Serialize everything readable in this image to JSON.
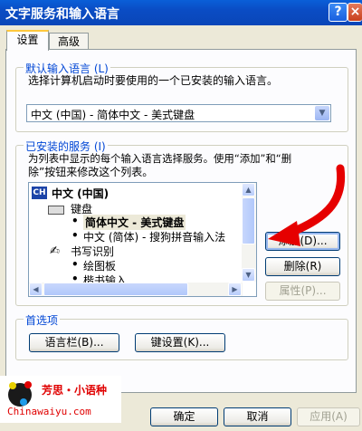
{
  "title": "文字服务和输入语言",
  "title_buttons": {
    "help": "?",
    "close": "×"
  },
  "tabs": [
    {
      "label": "设置"
    },
    {
      "label": "高级"
    }
  ],
  "default_language": {
    "legend": "默认输入语言 (L)",
    "description": "选择计算机启动时要使用的一个已安装的输入语言。",
    "selected": "中文 (中国) - 简体中文 - 美式键盘"
  },
  "installed_services": {
    "legend": "已安装的服务 (I)",
    "description_line1": "为列表中显示的每个输入语言选择服务。使用“添加”和“删",
    "description_line2": "除”按钮来修改这个列表。",
    "tree": {
      "language_icon": "CH",
      "language": "中文 (中国)",
      "keyboard_group": "键盘",
      "keyboard_items": [
        "简体中文 - 美式键盘",
        "中文 (简体) - 搜狗拼音输入法"
      ],
      "handwriting_group": "书写识别",
      "handwriting_items": [
        "绘图板",
        "楷书输入"
      ]
    },
    "buttons": {
      "add": "添加(D)...",
      "remove": "删除(R)",
      "properties": "属性(P)..."
    }
  },
  "preferences": {
    "legend": "首选项",
    "language_bar": "语言栏(B)...",
    "key_settings": "键设置(K)..."
  },
  "footer": {
    "ok": "确定",
    "cancel": "取消",
    "apply": "应用(A)"
  },
  "watermark": {
    "name": "芳思・小语种",
    "site": "Chinawaiyu.com"
  },
  "colors": {
    "title_bar": "#0a4cc4",
    "dialog_bg": "#ece9d8",
    "arrow": "#e60000",
    "legend_text": "#0046d5"
  }
}
